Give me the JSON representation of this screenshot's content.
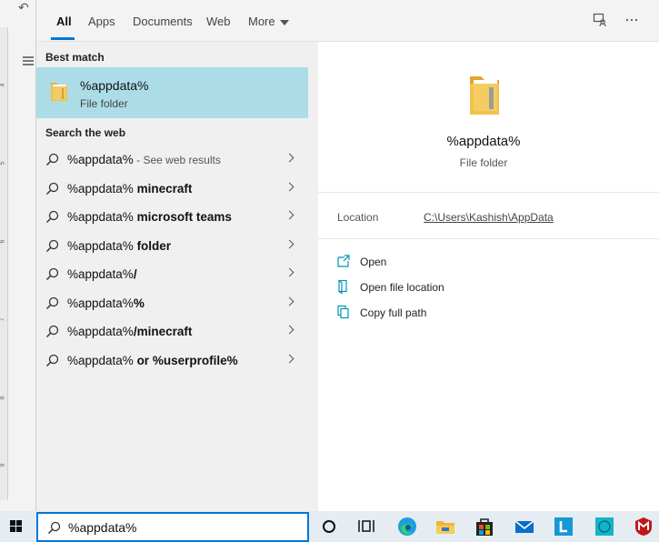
{
  "tabs": [
    {
      "label": "All",
      "active": true
    },
    {
      "label": "Apps"
    },
    {
      "label": "Documents"
    },
    {
      "label": "Web"
    },
    {
      "label": "More"
    }
  ],
  "top_icons": [
    "feedback-icon",
    "more-options-icon"
  ],
  "best_match": {
    "heading": "Best match",
    "title": "%appdata%",
    "subtitle": "File folder"
  },
  "web": {
    "heading": "Search the web",
    "results": [
      {
        "prefix": "%appdata%",
        "bold": "",
        "hint": " - See web results"
      },
      {
        "prefix": "%appdata% ",
        "bold": "minecraft",
        "hint": ""
      },
      {
        "prefix": "%appdata% ",
        "bold": "microsoft teams",
        "hint": ""
      },
      {
        "prefix": "%appdata% ",
        "bold": "folder",
        "hint": ""
      },
      {
        "prefix": "%appdata%",
        "bold": "/",
        "hint": ""
      },
      {
        "prefix": "%appdata%",
        "bold": "%",
        "hint": ""
      },
      {
        "prefix": "%appdata%",
        "bold": "/minecraft",
        "hint": ""
      },
      {
        "prefix": "%appdata% ",
        "bold": "or %userprofile%",
        "hint": ""
      }
    ]
  },
  "preview": {
    "title": "%appdata%",
    "kind": "File folder",
    "location_label": "Location",
    "location_value": "C:\\Users\\Kashish\\AppData",
    "actions": [
      {
        "label": "Open",
        "icon": "open-icon"
      },
      {
        "label": "Open file location",
        "icon": "file-location-icon"
      },
      {
        "label": "Copy full path",
        "icon": "copy-path-icon"
      }
    ]
  },
  "search": {
    "value": "%appdata%"
  },
  "taskbar_icons": [
    "cortana-icon",
    "task-view-icon",
    "edge-icon",
    "file-explorer-icon",
    "store-icon",
    "mail-icon",
    "app-l-icon",
    "app-square-icon",
    "mcafee-icon"
  ],
  "background_ruler": [
    "4",
    "5",
    "6",
    "7",
    "8",
    "9"
  ],
  "colors": {
    "accent": "#0078d7",
    "selection": "#acdde7",
    "folder": "#f0c24b"
  }
}
